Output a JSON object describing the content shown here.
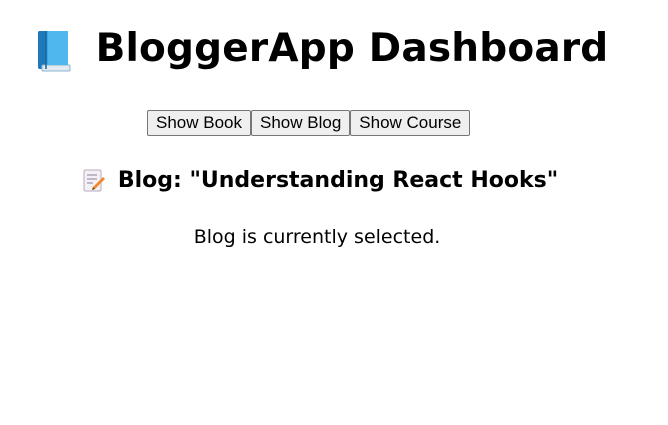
{
  "header": {
    "title": "BloggerApp Dashboard",
    "icon": "blue-book-icon"
  },
  "toolbar": {
    "buttons": [
      {
        "label": "Show Book"
      },
      {
        "label": "Show Blog"
      },
      {
        "label": "Show Course"
      }
    ]
  },
  "content": {
    "heading": "Blog: \"Understanding React Hooks\"",
    "heading_icon": "memo-icon",
    "status": "Blog is currently selected."
  },
  "colors": {
    "background": "#ffffff",
    "text": "#000000",
    "button_bg": "#efefef",
    "button_border": "#767676",
    "book_icon": "#2e9bd6"
  }
}
